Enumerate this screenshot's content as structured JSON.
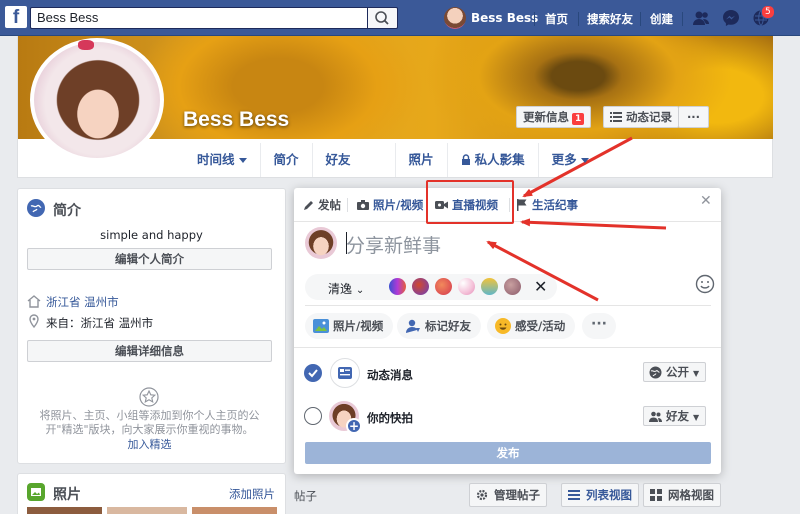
{
  "topbar": {
    "logo": "f",
    "search_value": "Bess Bess",
    "user_name": "Bess Bess",
    "links": [
      "首页",
      "搜索好友",
      "创建"
    ],
    "notifications_count": "5",
    "icons": [
      "search-icon",
      "friends-icon",
      "messenger-icon",
      "globe-icon"
    ]
  },
  "profile": {
    "name": "Bess Bess",
    "update_info_label": "更新信息",
    "update_info_count": "1",
    "activity_log_label": "动态记录",
    "more_label": "···",
    "nav": [
      "时间线",
      "简介",
      "好友",
      "照片",
      "私人影集",
      "更多"
    ]
  },
  "intro": {
    "title": "简介",
    "bio": "simple and happy",
    "edit_bio_label": "编辑个人简介",
    "lives_in": "浙江省 温州市",
    "from": "来自：浙江省 温州市",
    "edit_details_label": "编辑详细信息",
    "featured_text": "将照片、主页、小组等添加到你个人主页的公开\"精选\"版块，向大家展示你重视的事物。",
    "featured_link": "加入精选"
  },
  "photos": {
    "title": "照片",
    "add_link": "添加照片"
  },
  "composer": {
    "tabs": [
      "发帖",
      "照片/视频",
      "直播视频",
      "生活纪事"
    ],
    "placeholder": "分享新鲜事",
    "style_label": "清逸",
    "swatches": [
      "#6a3fbf",
      "#c0392b",
      "#e96a4a",
      "#f4c0d8",
      "#8ec63f",
      "#b07a7a"
    ],
    "chips": [
      "照片/视频",
      "标记好友",
      "感受/活动"
    ],
    "more": "···",
    "news_feed_label": "动态消息",
    "news_feed_privacy": "公开",
    "story_label": "你的快拍",
    "story_privacy": "好友",
    "publish_label": "发布"
  },
  "posts_bar": {
    "label": "帖子",
    "manage": "管理帖子",
    "list_view": "列表视图",
    "grid_view": "网格视图"
  },
  "colors": {
    "brand": "#3b5998",
    "link": "#365899",
    "annotation": "#e3322a"
  }
}
